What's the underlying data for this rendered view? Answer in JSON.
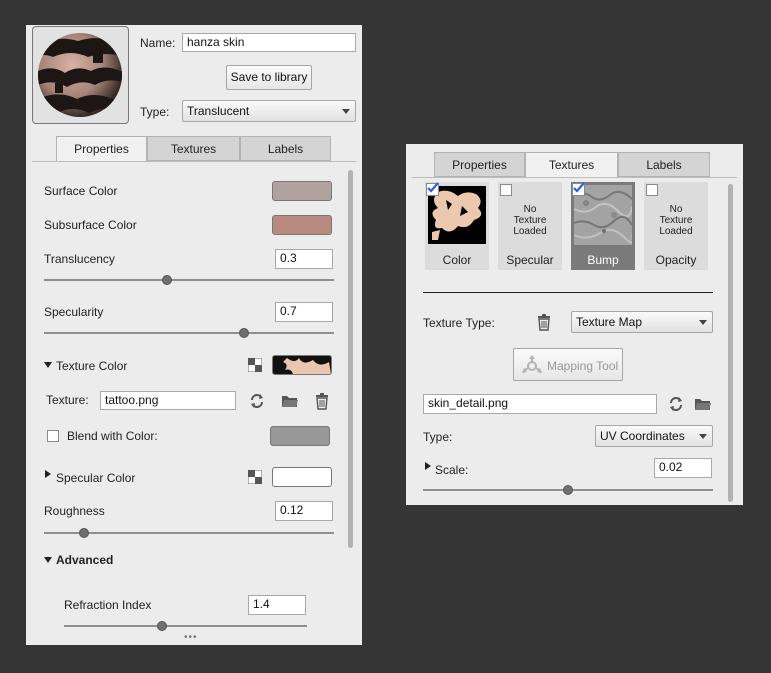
{
  "left_panel": {
    "name_label": "Name:",
    "name_value": "hanza skin",
    "save_button": "Save to library",
    "type_label": "Type:",
    "type_value": "Translucent",
    "tabs": [
      {
        "label": "Properties",
        "active": true
      },
      {
        "label": "Textures",
        "active": false
      },
      {
        "label": "Labels",
        "active": false
      }
    ],
    "surface_color": {
      "label": "Surface Color",
      "color": "#b0a39f"
    },
    "subsurface_color": {
      "label": "Subsurface Color",
      "color": "#b98b80"
    },
    "translucency": {
      "label": "Translucency",
      "value": "0.3",
      "fraction": 0.3
    },
    "specularity": {
      "label": "Specularity",
      "value": "0.7",
      "fraction": 0.7
    },
    "texture_color": {
      "label": "Texture Color",
      "texture_label": "Texture:",
      "texture_value": "tattoo.png",
      "blend_label": "Blend with Color:",
      "blend_checked": false,
      "blend_color": "#989898"
    },
    "specular_color": {
      "label": "Specular Color",
      "color": "#ffffff"
    },
    "roughness": {
      "label": "Roughness",
      "value": "0.12",
      "fraction": 0.12
    },
    "advanced": {
      "label": "Advanced"
    },
    "refraction": {
      "label": "Refraction Index",
      "value": "1.4",
      "fraction": 0.4
    },
    "more_indicator": "•••"
  },
  "right_panel": {
    "tabs": [
      {
        "label": "Properties",
        "active": false
      },
      {
        "label": "Textures",
        "active": true
      },
      {
        "label": "Labels",
        "active": false
      }
    ],
    "tiles": [
      {
        "label": "Color",
        "checked": true,
        "loaded": true,
        "selected": false
      },
      {
        "label": "Specular",
        "checked": false,
        "loaded": false,
        "no_texture_text": "No\nTexture\nLoaded",
        "selected": false
      },
      {
        "label": "Bump",
        "checked": true,
        "loaded": true,
        "selected": true
      },
      {
        "label": "Opacity",
        "checked": false,
        "loaded": false,
        "no_texture_text": "No\nTexture\nLoaded",
        "selected": false
      }
    ],
    "texture_type_label": "Texture Type:",
    "texture_type_value": "Texture Map",
    "mapping_tool": "Mapping Tool",
    "file_value": "skin_detail.png",
    "type_label": "Type:",
    "type_value": "UV Coordinates",
    "scale": {
      "label": "Scale:",
      "value": "0.02",
      "fraction": 0.5
    }
  },
  "colors": {
    "background": "#353535",
    "panel": "#ececec",
    "checkmark": "#2a63d8"
  }
}
